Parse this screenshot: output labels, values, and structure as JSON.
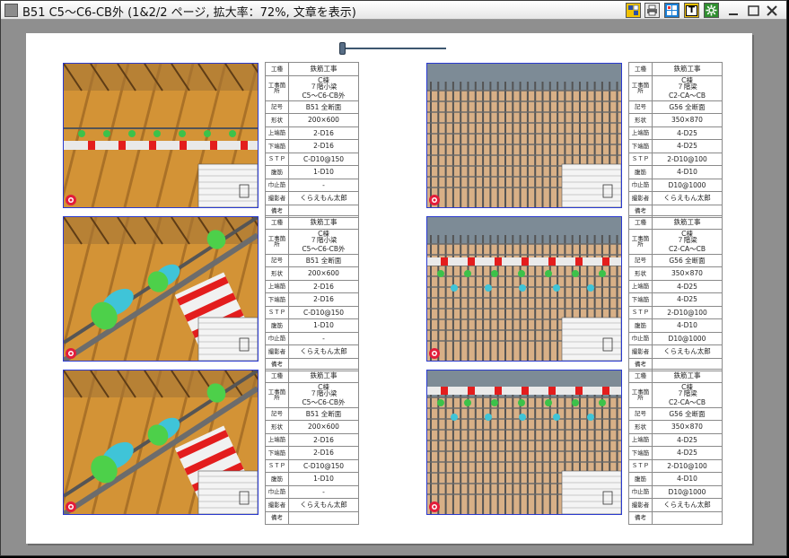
{
  "window": {
    "title": "B51 C5～C6-CB外 (1&2/2 ページ, 拡大率：72%, 文章を表示)"
  },
  "toolbar": [
    {
      "name": "layout-icon",
      "bg": "#f2c200"
    },
    {
      "name": "print-icon",
      "bg": "#e8e8e8"
    },
    {
      "name": "grid-icon",
      "bg": "#1a7fd6"
    },
    {
      "name": "text-icon",
      "bg": "#f2c200",
      "glyph": "T"
    },
    {
      "name": "settings-icon",
      "bg": "#2f8f2f"
    }
  ],
  "colors": {
    "photo_border": "#2a3ad0",
    "window_bg": "#8f8f8f",
    "paper": "#ffffff"
  },
  "labels": {
    "koushu": "工種",
    "kouji_kasho": "工事箇所",
    "kigou": "記号",
    "keijou": "形状",
    "uwaba": "上端筋",
    "shitaba": "下端筋",
    "stp": "ＳＴＰ",
    "fukkin": "腹筋",
    "habadome": "巾止筋",
    "satsuei": "撮影者",
    "bikou": "備考"
  },
  "left_card": {
    "koushu": "鉄筋工事",
    "kasho_a": "C棟",
    "kasho_b": "７階小梁",
    "kasho_c": "C5～C6-CB外",
    "kigou": "B51 全断面",
    "keijou": "200×600",
    "uwaba": "2-D16",
    "shitaba": "2-D16",
    "stp": "C-D10@150",
    "fukkin": "1-D10",
    "habadome": "-",
    "satsuei": "くらえもん太郎",
    "bikou": ""
  },
  "right_card": {
    "koushu": "鉄筋工事",
    "kasho_a": "C棟",
    "kasho_b": "７階梁",
    "kasho_c": "C2-CA～CB",
    "kigou": "G56 全断面",
    "keijou": "350×870",
    "uwaba": "4-D25",
    "shitaba": "4-D25",
    "stp": "2-D10@100",
    "fukkin": "4-D10",
    "habadome": "D10@1000",
    "satsuei": "くらえもん太郎",
    "bikou": ""
  }
}
